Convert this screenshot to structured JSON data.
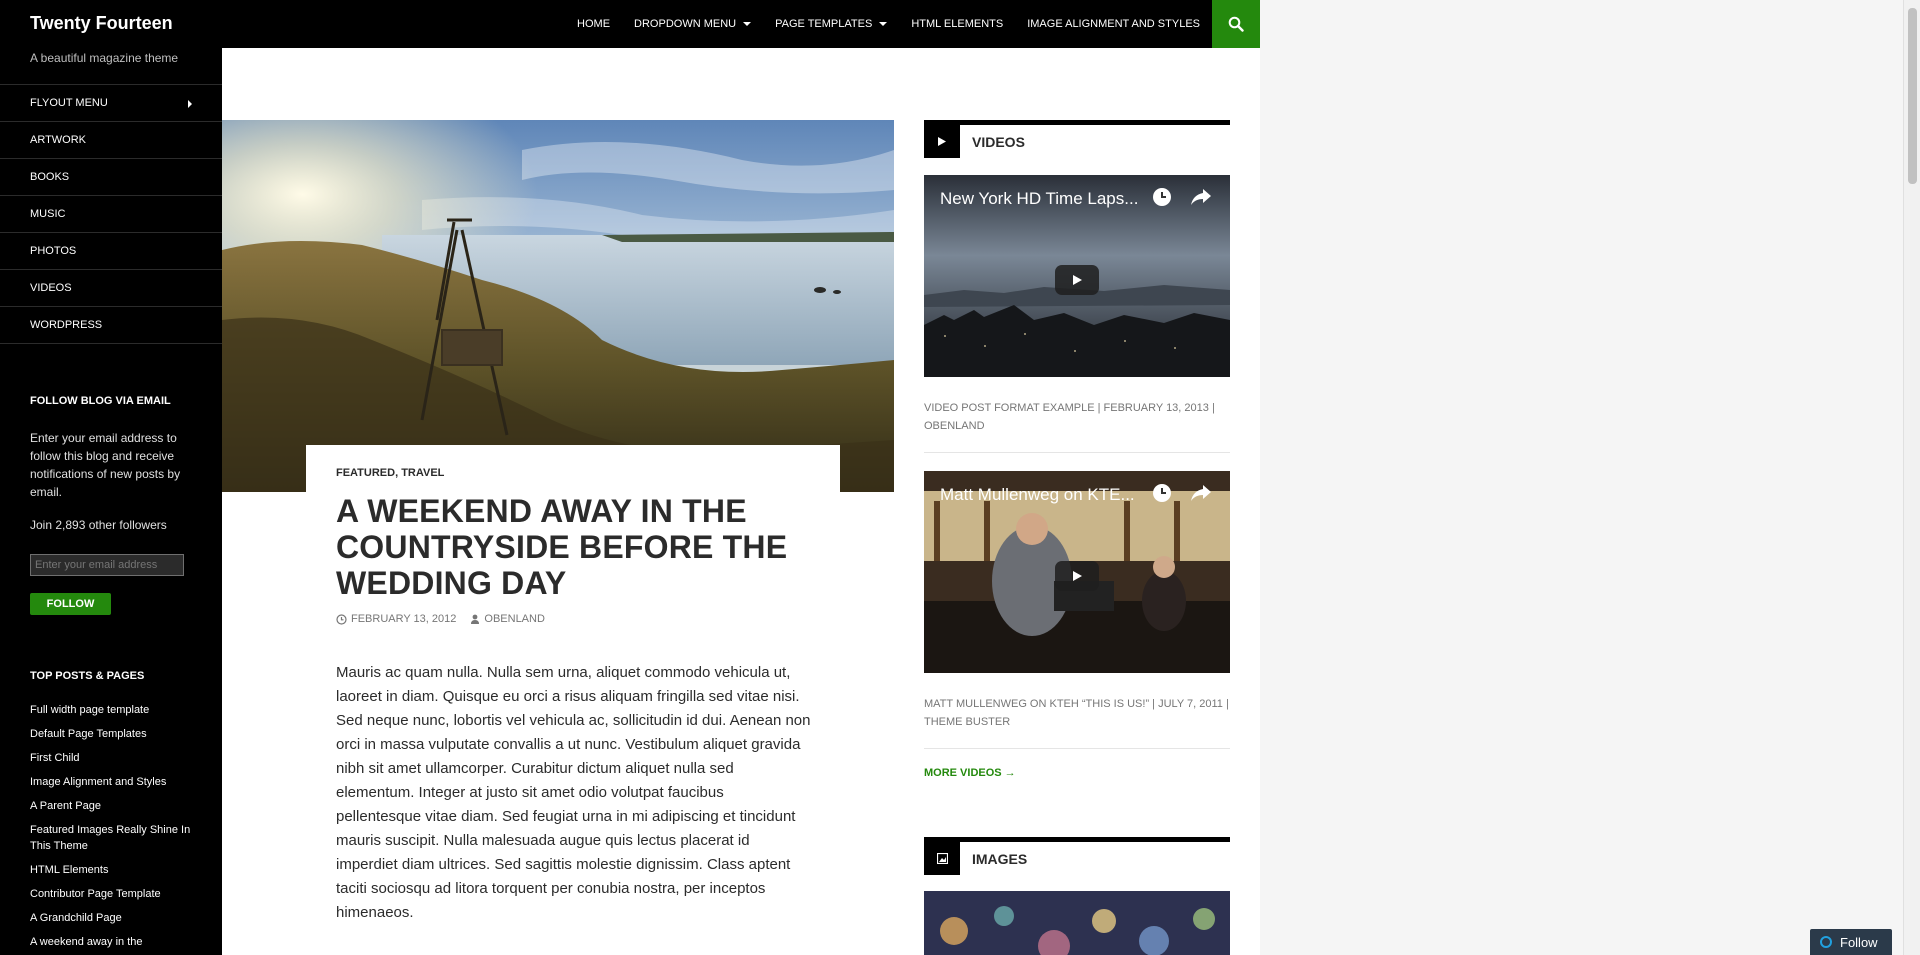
{
  "site": {
    "title": "Twenty Fourteen",
    "description": "A beautiful magazine theme"
  },
  "primary_nav": [
    {
      "label": "HOME",
      "dropdown": false
    },
    {
      "label": "DROPDOWN MENU",
      "dropdown": true
    },
    {
      "label": "PAGE TEMPLATES",
      "dropdown": true
    },
    {
      "label": "HTML ELEMENTS",
      "dropdown": false
    },
    {
      "label": "IMAGE ALIGNMENT AND STYLES",
      "dropdown": false
    }
  ],
  "search_icon": "search-icon",
  "side_menu": [
    {
      "label": "FLYOUT MENU"
    },
    {
      "label": "ARTWORK"
    },
    {
      "label": "BOOKS"
    },
    {
      "label": "MUSIC"
    },
    {
      "label": "PHOTOS"
    },
    {
      "label": "VIDEOS"
    },
    {
      "label": "WORDPRESS"
    }
  ],
  "follow_widget": {
    "title": "FOLLOW BLOG VIA EMAIL",
    "text": "Enter your email address to follow this blog and receive notifications of new posts by email.",
    "count": "Join 2,893 other followers",
    "placeholder": "Enter your email address",
    "button": "FOLLOW"
  },
  "top_posts": {
    "title": "TOP POSTS & PAGES",
    "items": [
      "Full width page template",
      "Default Page Templates",
      "First Child",
      "Image Alignment and Styles",
      "A Parent Page",
      "Featured Images Really Shine In This Theme",
      "HTML Elements",
      "Contributor Page Template",
      "A Grandchild Page",
      "A weekend away in the"
    ]
  },
  "post": {
    "categories": [
      "FEATURED",
      "TRAVEL"
    ],
    "cat_sep": ", ",
    "title": "A WEEKEND AWAY IN THE COUNTRYSIDE BEFORE THE WEDDING DAY",
    "date": "FEBRUARY 13, 2012",
    "author": "OBENLAND",
    "content": "Mauris ac quam nulla. Nulla sem urna, aliquet commodo vehicula ut, laoreet in diam. Quisque eu orci a risus aliquam fringilla sed vitae nisi. Sed neque nunc, lobortis vel vehicula ac, sollicitudin id dui. Aenean non orci in massa vulputate convallis a ut nunc. Vestibulum aliquet gravida nibh sit amet ullamcorper. Curabitur dictum aliquet nulla sed elementum. Integer at justo sit amet odio volutpat faucibus pellentesque vitae diam. Sed feugiat urna in mi adipiscing et tincidunt mauris suscipit. Nulla malesuada augue quis lectus placerat id imperdiet diam ultrices. Sed sagittis molestie dignissim. Class aptent taciti sociosqu ad litora torquent per conubia nostra, per inceptos himenaeos."
  },
  "videos_widget": {
    "title": "VIDEOS",
    "videos": [
      {
        "title": "New York HD Time Laps...",
        "meta": "VIDEO POST FORMAT EXAMPLE | FEBRUARY 13, 2013 | OBENLAND"
      },
      {
        "title": "Matt Mullenweg on KTE...",
        "meta": "MATT MULLENWEG ON KTEH “THIS IS US!” | JULY 7, 2011 | THEME BUSTER"
      }
    ],
    "more": "MORE VIDEOS →"
  },
  "images_widget": {
    "title": "IMAGES"
  },
  "float_follow": "Follow",
  "colors": {
    "accent": "#24890d",
    "header_bg": "#000000",
    "sidebar_bg": "#000000"
  }
}
